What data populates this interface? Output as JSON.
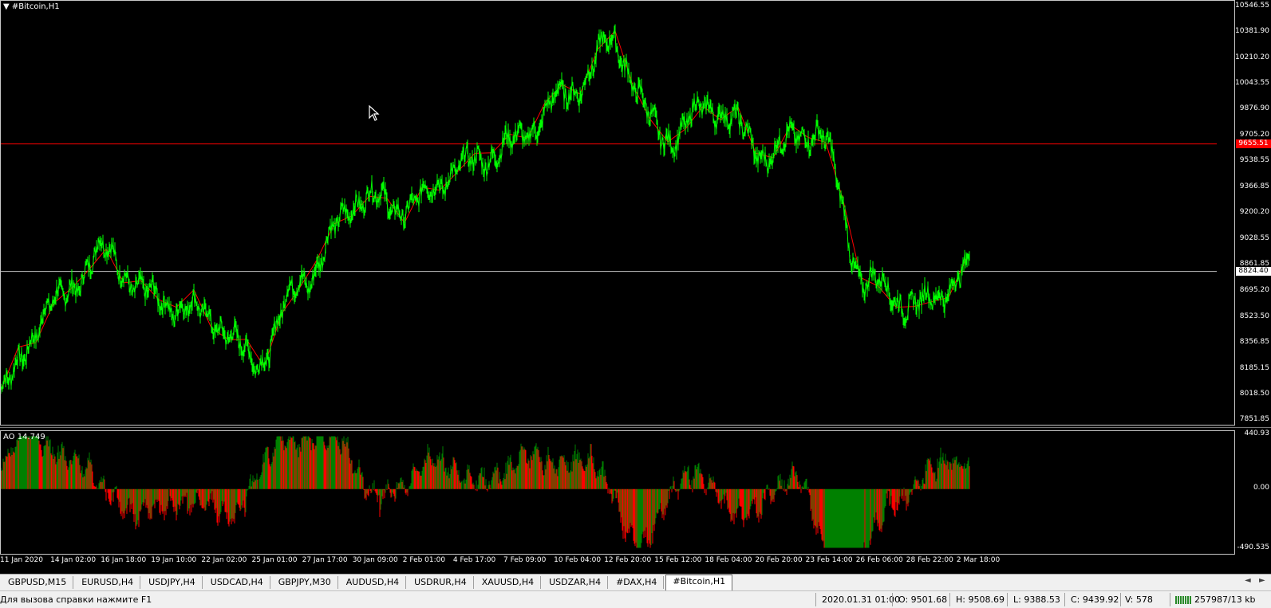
{
  "chart": {
    "title": "#Bitcoin,H1",
    "price_labels": [
      "10546.55",
      "10381.90",
      "10210.20",
      "10043.55",
      "9876.90",
      "9705.20",
      "9538.55",
      "9366.85",
      "9200.20",
      "9028.55",
      "8861.85",
      "8695.20",
      "8523.50",
      "8356.85",
      "8185.15",
      "8018.50",
      "7851.85"
    ],
    "red_line_price": "9655.51",
    "current_price": "8824.40",
    "time_labels": [
      "11 Jan 2020",
      "14 Jan 02:00",
      "16 Jan 18:00",
      "19 Jan 10:00",
      "22 Jan 02:00",
      "25 Jan 01:00",
      "27 Jan 17:00",
      "30 Jan 09:00",
      "2 Feb 01:00",
      "4 Feb 17:00",
      "7 Feb 09:00",
      "10 Feb 04:00",
      "12 Feb 20:00",
      "15 Feb 12:00",
      "18 Feb 04:00",
      "20 Feb 20:00",
      "23 Feb 14:00",
      "26 Feb 06:00",
      "28 Feb 22:00",
      "2 Mar 18:00"
    ],
    "colors": {
      "candles": "#00ff00",
      "zigzag": "#ff0000",
      "red_line": "#ff0000",
      "bid_line": "#c0c0c0",
      "ao_up": "#008000",
      "ao_down": "#ff0000"
    }
  },
  "chart_data": {
    "type": "line",
    "title": "#Bitcoin,H1",
    "ylim": [
      7851.85,
      10546.55
    ],
    "x": [
      "11 Jan 2020",
      "14 Jan 02:00",
      "16 Jan 18:00",
      "19 Jan 10:00",
      "22 Jan 02:00",
      "25 Jan 01:00",
      "27 Jan 17:00",
      "30 Jan 09:00",
      "2 Feb 01:00",
      "4 Feb 17:00",
      "7 Feb 09:00",
      "10 Feb 04:00",
      "12 Feb 20:00",
      "15 Feb 12:00",
      "18 Feb 04:00",
      "20 Feb 20:00",
      "23 Feb 14:00",
      "26 Feb 06:00",
      "28 Feb 22:00",
      "2 Mar 18:00"
    ],
    "series": [
      {
        "values": [
          8050,
          8600,
          8950,
          8650,
          8550,
          8250,
          8800,
          9300,
          9250,
          9500,
          9650,
          9950,
          10300,
          9700,
          9900,
          9600,
          9750,
          8750,
          8600,
          8820
        ]
      }
    ],
    "indicator": {
      "name": "AO",
      "current": "14.749",
      "ylim": [
        -490.535,
        440.93
      ],
      "labels": [
        "440.93",
        "0.00",
        "-490.535"
      ]
    }
  },
  "tabs": [
    "GBPUSD,M15",
    "EURUSD,H4",
    "USDJPY,H4",
    "USDCAD,H4",
    "GBPJPY,M30",
    "AUDUSD,H4",
    "USDRUR,H4",
    "XAUUSD,H4",
    "USDZAR,H4",
    "#DAX,H4",
    "#Bitcoin,H1"
  ],
  "active_tab": "#Bitcoin,H1",
  "status": {
    "help": "Для вызова справки нажмите F1",
    "datetime": "2020.01.31 01:00",
    "open": "O: 9501.68",
    "high": "H: 9508.69",
    "low": "L: 9388.53",
    "close": "C: 9439.92",
    "volume": "V: 578",
    "traffic": "257987/13 kb"
  }
}
